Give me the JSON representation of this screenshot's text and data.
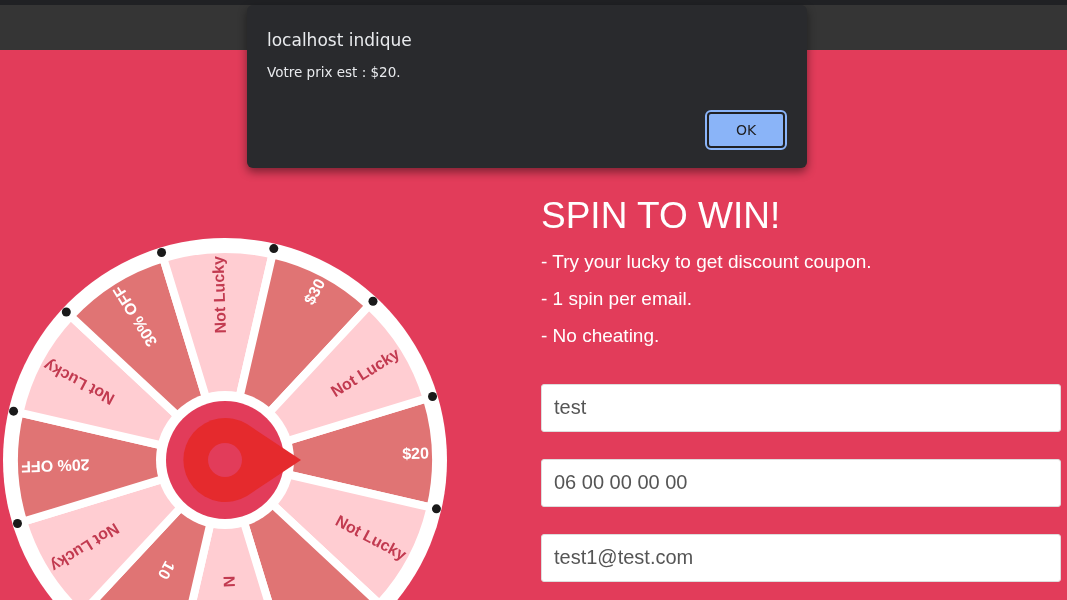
{
  "dialog": {
    "title": "localhost indique",
    "message": "Votre prix est : $20.",
    "button": "OK"
  },
  "wheel": {
    "segments": [
      {
        "label": "$20",
        "color": "#e07474",
        "kind": "full"
      },
      {
        "label": "Not Lucky",
        "color": "#ffcdd2",
        "kind": "full"
      },
      {
        "color": "#e07474"
      },
      {
        "label": "N",
        "color": "#ffcdd2",
        "kind": "cut"
      },
      {
        "label": "10",
        "color": "#e07474",
        "kind": "cut"
      },
      {
        "label": "Not Lucky",
        "color": "#ffcdd2",
        "kind": "full"
      },
      {
        "label": "20% OFF",
        "color": "#e07474",
        "kind": "full"
      },
      {
        "label": "Not Lucky",
        "color": "#ffcdd2",
        "kind": "full"
      },
      {
        "label": "30% OFF",
        "color": "#e07474",
        "kind": "full"
      },
      {
        "label": "Not Lucky",
        "color": "#ffcdd2",
        "kind": "full"
      },
      {
        "label": "$30",
        "color": "#e07474",
        "kind": "full"
      },
      {
        "label": "Not Lucky",
        "color": "#ffcdd2",
        "kind": "full"
      }
    ]
  },
  "form": {
    "title": "SPIN TO WIN!",
    "rules": [
      "- Try your lucky to get discount coupon.",
      "- 1 spin per email.",
      "- No cheating."
    ],
    "fields": [
      {
        "value": "test"
      },
      {
        "value": "06 00 00 00 00"
      },
      {
        "value": "test1@test.com"
      }
    ]
  }
}
